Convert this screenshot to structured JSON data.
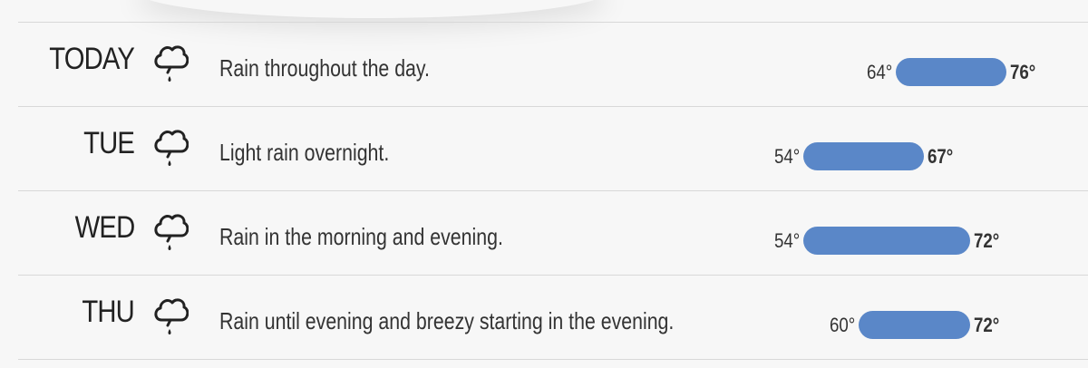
{
  "forecast": [
    {
      "day": "TODAY",
      "icon": "rain-cloud-icon",
      "summary": "Rain throughout the day.",
      "low": "64°",
      "high": "76°",
      "low_value": 64,
      "high_value": 76
    },
    {
      "day": "TUE",
      "icon": "rain-cloud-icon",
      "summary": "Light rain overnight.",
      "low": "54°",
      "high": "67°",
      "low_value": 54,
      "high_value": 67
    },
    {
      "day": "WED",
      "icon": "rain-cloud-icon",
      "summary": "Rain in the morning and evening.",
      "low": "54°",
      "high": "72°",
      "low_value": 54,
      "high_value": 72
    },
    {
      "day": "THU",
      "icon": "rain-cloud-icon",
      "summary": "Rain until evening and breezy starting in the evening.",
      "low": "60°",
      "high": "72°",
      "low_value": 60,
      "high_value": 72
    }
  ],
  "colors": {
    "bar": "#5a87c8",
    "text": "#333333",
    "divider": "#d8d8d8",
    "background": "#f7f7f7"
  }
}
